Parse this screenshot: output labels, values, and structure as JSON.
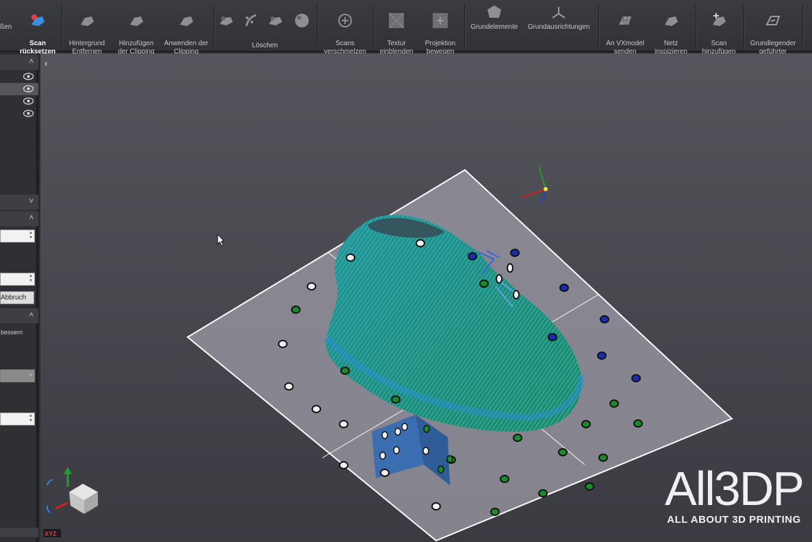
{
  "ribbon": {
    "partial_left": "ßen",
    "reset_scan": "Scan\nrücksetzen",
    "remove_background": "Hintergrund\nEntfernen",
    "add_clipping_plane": "Hinzufügen\nder Clipping\nEbene",
    "apply_clipping_ref": "Anwenden der\nClipping\nReferenz",
    "delete_group": "Löschen",
    "merge_scans": "Scans\nverschmelzen",
    "show_texture": "Textur\neinblenden",
    "move_projection": "Projektion\nbewegen",
    "primitives": "Grundelemente",
    "alignments": "Grundausrichtungen",
    "send_vxmodel": "An VXmodel\nsenden",
    "inspect_mesh": "Netz\ninspizieren",
    "add_scan": "Scan\nhinzufügen",
    "guided_workflow": "Grundlegender\ngeführter\nWorkflow"
  },
  "left_panel": {
    "cancel_button": "Abbruch",
    "improve_text": "bessern"
  },
  "viewport": {
    "axis_label": "XYZ"
  },
  "watermark": {
    "logo": "All3DP",
    "tagline": "ALL ABOUT 3D PRINTING"
  },
  "colors": {
    "ribbon_bg": "#34363a",
    "viewport_top": "#55555c",
    "scan_green": "#2fc86a",
    "scan_blue": "#2a7fd4",
    "target_blue": "#1a2bb0",
    "target_green": "#1a8a2a"
  }
}
